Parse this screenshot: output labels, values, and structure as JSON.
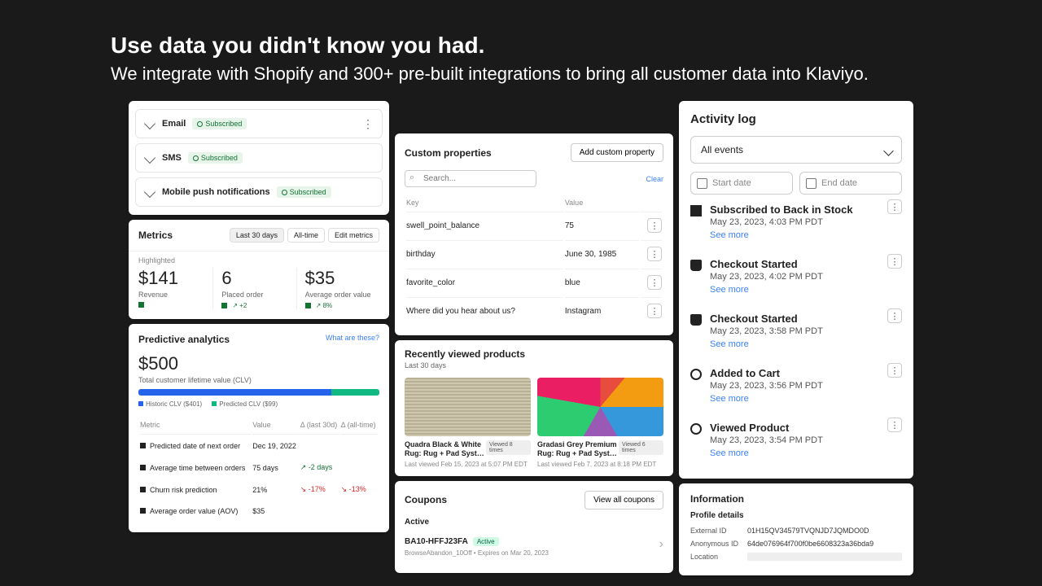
{
  "hero": {
    "title": "Use data you didn't know you had.",
    "subtitle": "We integrate with Shopify and 300+ pre-built integrations to bring all customer data into Klaviyo."
  },
  "channels": [
    {
      "name": "Email",
      "status": "Subscribed"
    },
    {
      "name": "SMS",
      "status": "Subscribed"
    },
    {
      "name": "Mobile push notifications",
      "status": "Subscribed"
    }
  ],
  "metrics": {
    "title": "Metrics",
    "ranges": [
      "Last 30 days",
      "All-time",
      "Edit metrics"
    ],
    "highlighted": "Highlighted",
    "items": [
      {
        "value": "$141",
        "label": "Revenue",
        "delta": ""
      },
      {
        "value": "6",
        "label": "Placed order",
        "delta": "↗ +2"
      },
      {
        "value": "$35",
        "label": "Average order value",
        "delta": "↗ 8%"
      }
    ]
  },
  "predictive": {
    "title": "Predictive analytics",
    "help": "What are these?",
    "amount": "$500",
    "caption": "Total customer lifetime value (CLV)",
    "historic_pct": 80,
    "predicted_pct": 20,
    "legend_h": "Historic CLV ($401)",
    "legend_p": "Predicted CLV ($99)",
    "cols": [
      "Metric",
      "Value",
      "Δ (last 30d)",
      "Δ (all-time)"
    ],
    "rows": [
      {
        "metric": "Predicted date of next order",
        "value": "Dec 19, 2022",
        "d30": "",
        "dall": ""
      },
      {
        "metric": "Average time between orders",
        "value": "75 days",
        "d30": "↗ -2 days",
        "dall": ""
      },
      {
        "metric": "Churn risk prediction",
        "value": "21%",
        "d30": "↘ -17%",
        "dall": "↘ -13%"
      },
      {
        "metric": "Average order value (AOV)",
        "value": "$35",
        "d30": "",
        "dall": ""
      }
    ]
  },
  "custom": {
    "title": "Custom properties",
    "add": "Add custom property",
    "search_ph": "Search...",
    "clear": "Clear",
    "cols": [
      "Key",
      "Value"
    ],
    "rows": [
      {
        "k": "swell_point_balance",
        "v": "75"
      },
      {
        "k": "birthday",
        "v": "June 30, 1985"
      },
      {
        "k": "favorite_color",
        "v": "blue"
      },
      {
        "k": "Where did you hear about us?",
        "v": "Instagram"
      }
    ]
  },
  "recent": {
    "title": "Recently viewed products",
    "sub": "Last 30 days",
    "items": [
      {
        "name": "Quadra Black & White Rug: Rug + Pad Syst…",
        "badge": "Viewed 8 times",
        "time": "Last viewed Feb 15, 2023 at 5:07 PM EDT"
      },
      {
        "name": "Gradasi Grey Premium Rug: Rug + Pad Syst…",
        "badge": "Viewed 6 times",
        "time": "Last viewed Feb 7, 2023 at 8:18 PM EDT"
      }
    ]
  },
  "coupons": {
    "title": "Coupons",
    "viewall": "View all coupons",
    "active": "Active",
    "code": "BA10-HFFJ23FA",
    "status": "Active",
    "desc": "BrowseAbandon_10Off • Expires on Mar 20, 2023"
  },
  "activity": {
    "title": "Activity log",
    "filter": "All events",
    "start": "Start date",
    "end": "End date",
    "see": "See more",
    "events": [
      {
        "icon": "sq",
        "title": "Subscribed to Back in Stock",
        "time": "May 23, 2023, 4:03 PM PDT"
      },
      {
        "icon": "bag",
        "title": "Checkout Started",
        "time": "May 23, 2023, 4:02 PM PDT"
      },
      {
        "icon": "bag",
        "title": "Checkout Started",
        "time": "May 23, 2023, 3:58 PM PDT"
      },
      {
        "icon": "gear",
        "title": "Added to Cart",
        "time": "May 23, 2023, 3:56 PM PDT"
      },
      {
        "icon": "gear",
        "title": "Viewed Product",
        "time": "May 23, 2023, 3:54 PM PDT"
      }
    ]
  },
  "info": {
    "title": "Information",
    "sub": "Profile details",
    "rows": [
      {
        "k": "External ID",
        "v": "01H15QV34579TVQNJD7JQMDO0D"
      },
      {
        "k": "Anonymous ID",
        "v": "64de076964f700f0be6608323a36bda9"
      }
    ],
    "loc": "Location"
  }
}
